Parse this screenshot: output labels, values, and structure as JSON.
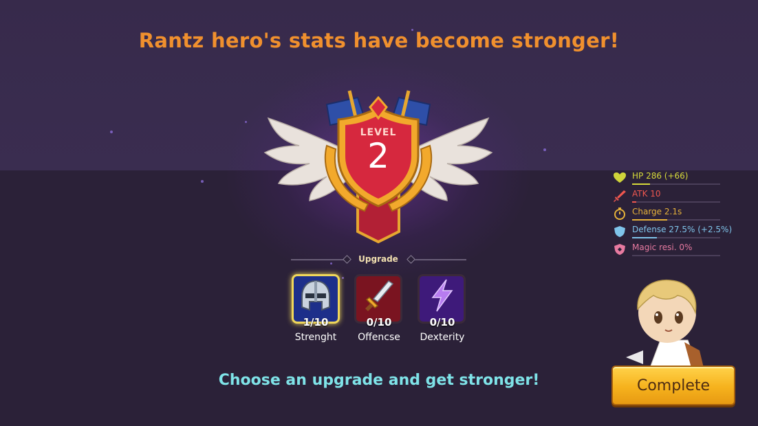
{
  "title": "Rantz hero's stats have become stronger!",
  "level": {
    "label": "LEVEL",
    "value": "2"
  },
  "upgrade_label": "Upgrade",
  "skills": [
    {
      "name": "Strenght",
      "count": "1/10",
      "icon": "helmet-icon",
      "selected": true
    },
    {
      "name": "Offencse",
      "count": "0/10",
      "icon": "sword-icon",
      "selected": false
    },
    {
      "name": "Dexterity",
      "count": "0/10",
      "icon": "lightning-icon",
      "selected": false
    }
  ],
  "subtitle": "Choose an upgrade and get stronger!",
  "stats": [
    {
      "text": "HP 286 (+66)",
      "icon": "heart-icon",
      "color": "#d7db3a",
      "fill": 0.2
    },
    {
      "text": "ATK 10",
      "icon": "sword-icon",
      "color": "#f0574f",
      "fill": 0.05
    },
    {
      "text": "Charge 2.1s",
      "icon": "stopwatch-icon",
      "color": "#e6b23a",
      "fill": 0.4
    },
    {
      "text": "Defense 27.5% (+2.5%)",
      "icon": "shield-icon",
      "color": "#7fc4ea",
      "fill": 0.28
    },
    {
      "text": "Magic resi. 0%",
      "icon": "magic-shield-icon",
      "color": "#e77aa0",
      "fill": 0.0
    }
  ],
  "complete_button": "Complete",
  "colors": {
    "title": "#f0902e",
    "subtitle": "#7fe3e8",
    "button": "#f6b21d",
    "emblem_red": "#d6283e",
    "emblem_gold": "#f2a92c"
  }
}
